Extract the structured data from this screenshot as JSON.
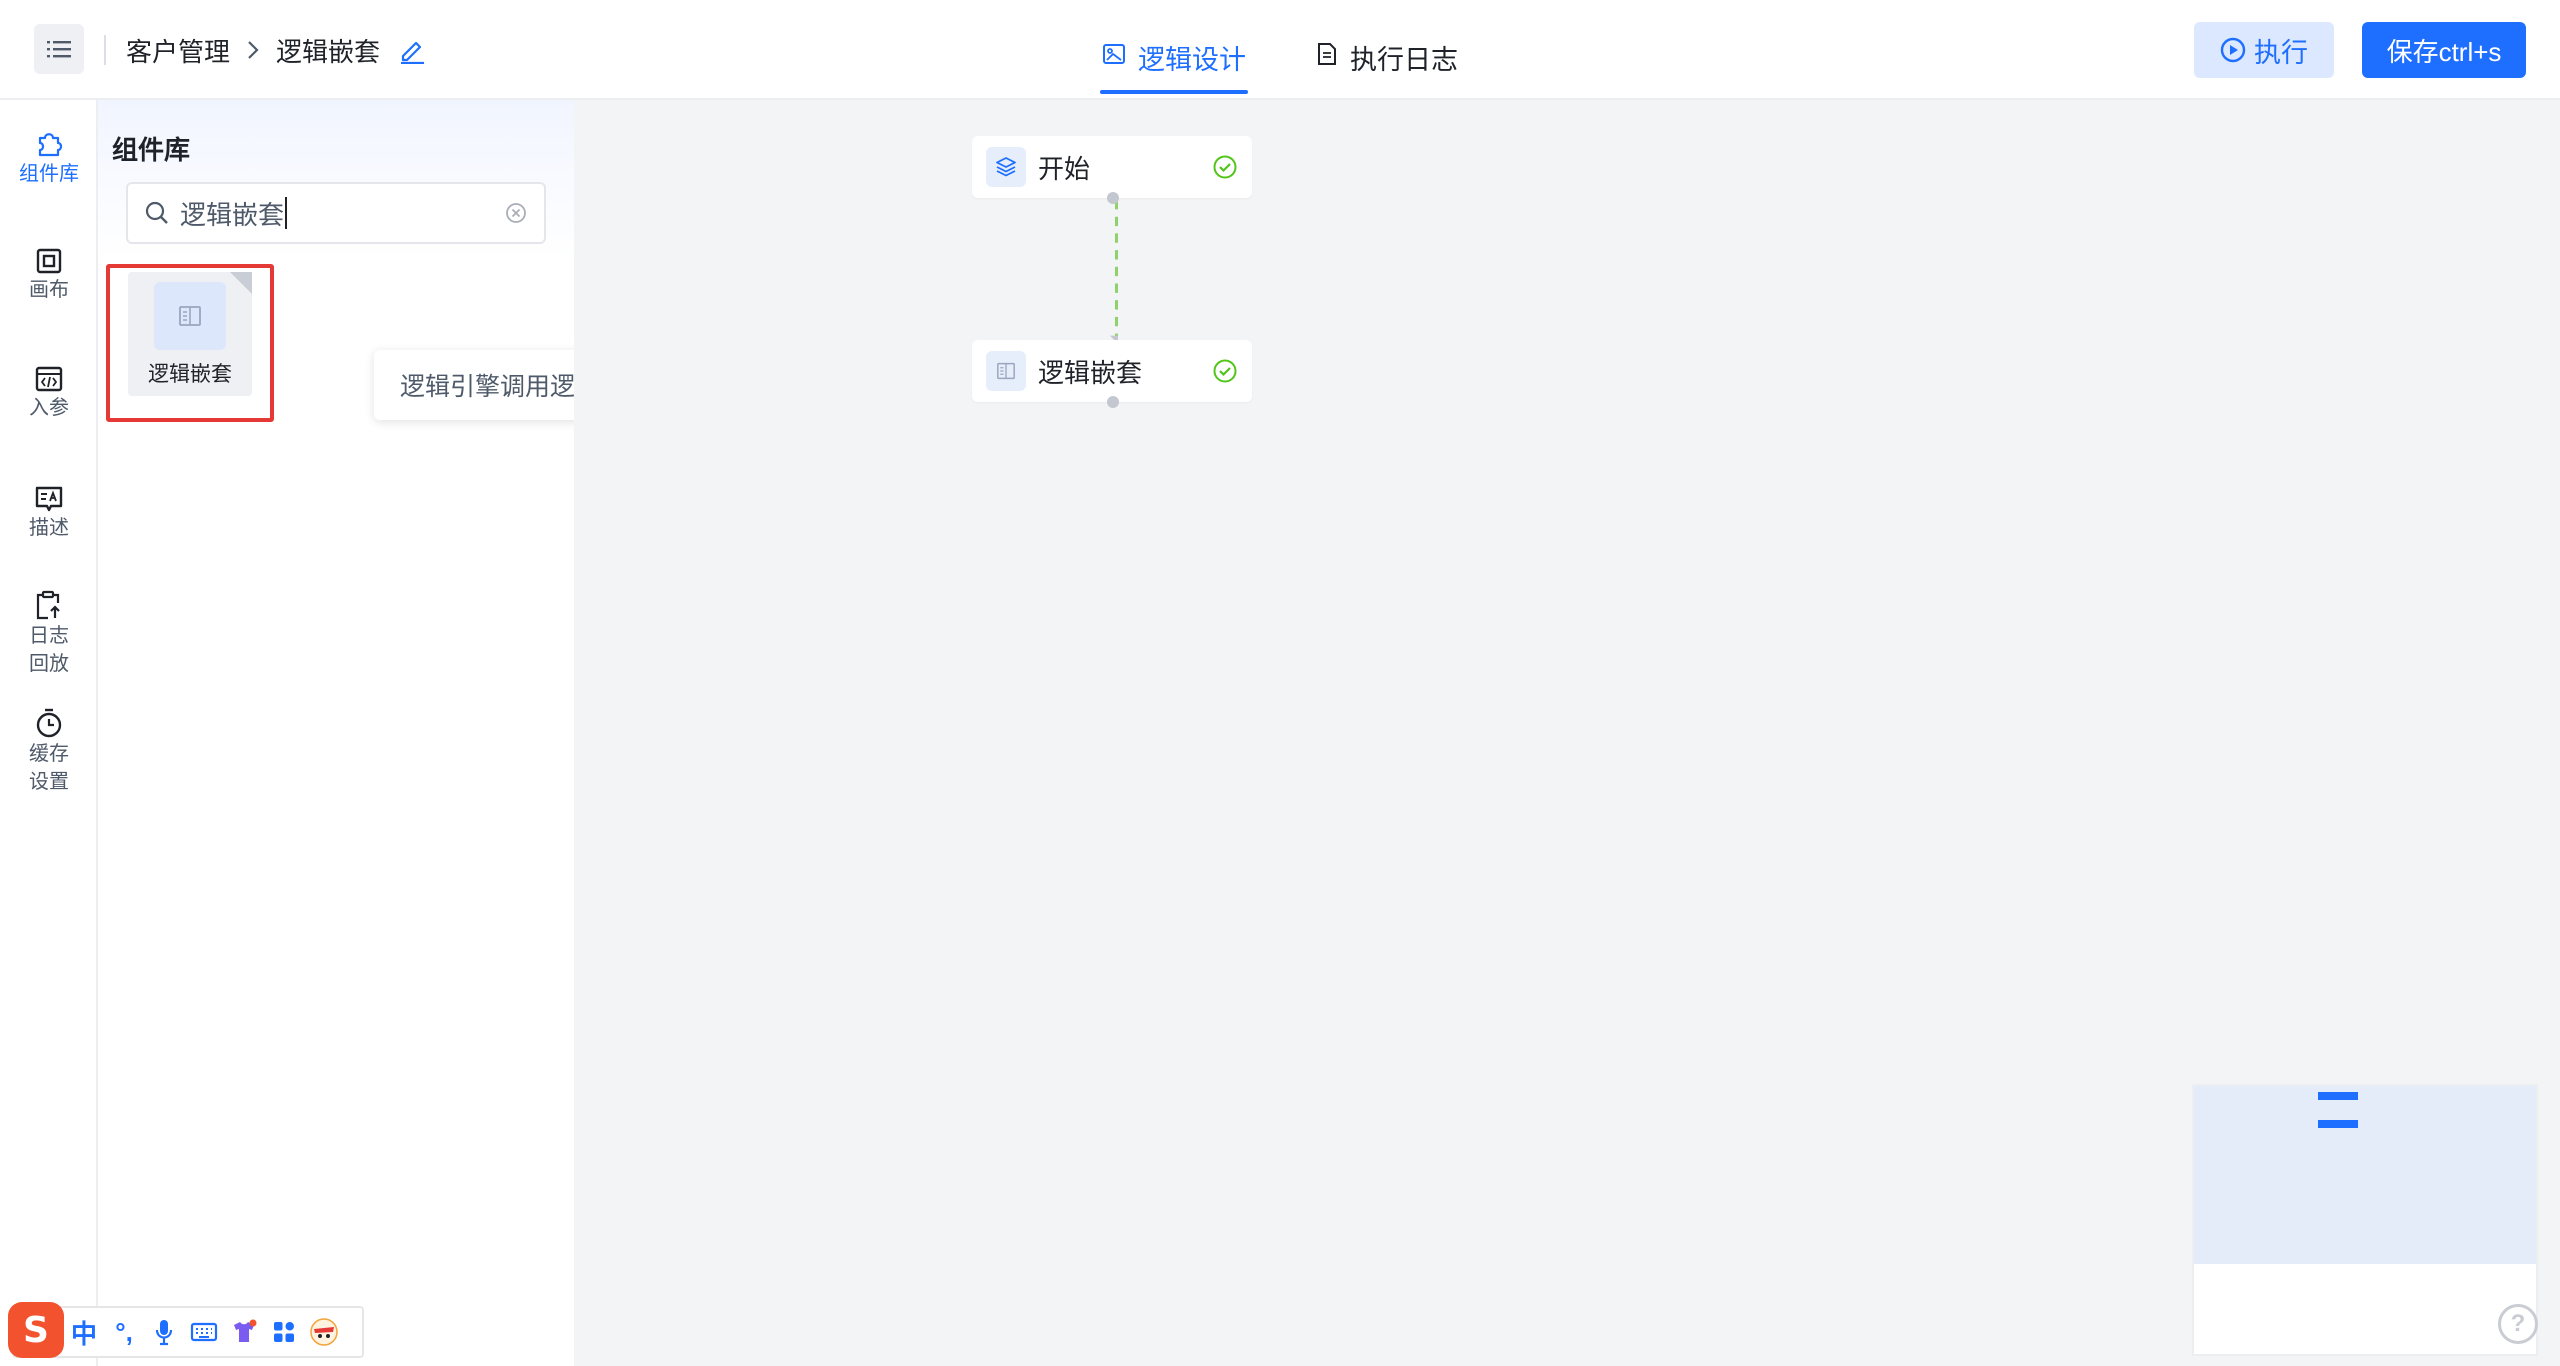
{
  "header": {
    "breadcrumb": {
      "parent": "客户管理",
      "current": "逻辑嵌套"
    },
    "tabs": [
      {
        "label": "逻辑设计",
        "active": true
      },
      {
        "label": "执行日志",
        "active": false
      }
    ],
    "run_label": "执行",
    "save_label": "保存ctrl+s"
  },
  "rail": {
    "items": [
      {
        "label": "组件库",
        "icon": "puzzle-icon",
        "active": true
      },
      {
        "label": "画布",
        "icon": "canvas-icon"
      },
      {
        "label": "入参",
        "icon": "code-window-icon"
      },
      {
        "label": "描述",
        "icon": "text-image-icon"
      },
      {
        "label_line1": "日志",
        "label_line2": "回放",
        "icon": "log-replay-icon"
      },
      {
        "label_line1": "缓存",
        "label_line2": "设置",
        "icon": "timer-icon"
      }
    ]
  },
  "panel": {
    "title": "组件库",
    "search_value": "逻辑嵌套",
    "component": {
      "label": "逻辑嵌套",
      "tooltip": "逻辑引擎调用逻辑引擎"
    }
  },
  "canvas": {
    "nodes": [
      {
        "label": "开始",
        "icon": "layers-icon",
        "status": "success"
      },
      {
        "label": "逻辑嵌套",
        "icon": "book-icon",
        "status": "success"
      }
    ]
  },
  "ime": {
    "logo": "S",
    "items": [
      "中",
      "°,",
      "microphone-icon",
      "keyboard-icon",
      "skin-icon",
      "apps-icon",
      "avatar-icon"
    ]
  },
  "colors": {
    "accent": "#1e6fff",
    "success": "#52c41a",
    "highlight": "#e53935",
    "edge": "#8fd16a"
  }
}
